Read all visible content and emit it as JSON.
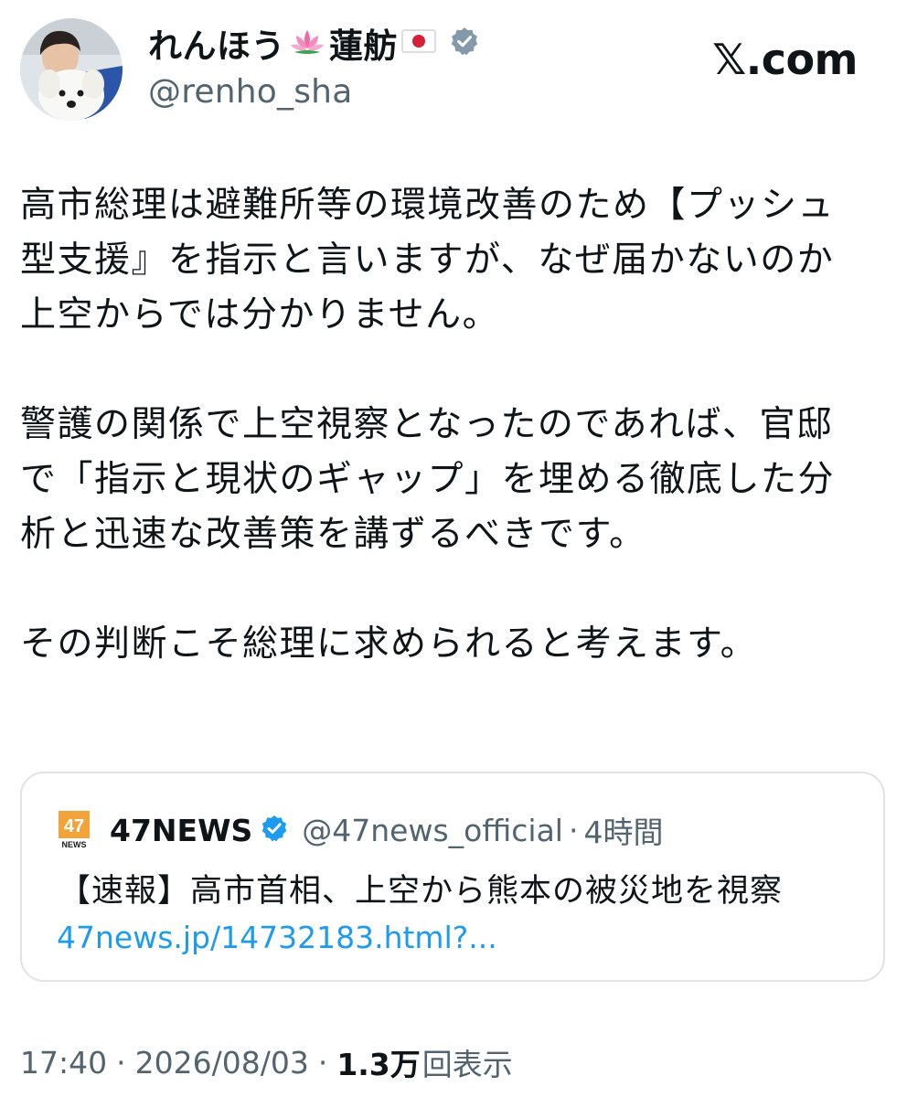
{
  "author": {
    "display_name": "れんほう",
    "display_name_2": "蓮舫",
    "handle": "@renho_sha"
  },
  "brand": "𝕏.com",
  "tweet": {
    "paragraphs": [
      "高市総理は避難所等の環境改善のため【プッシュ\n型支援』を指示と言いますが、なぜ届かないのか\n上空からでは分かりません。",
      "警護の関係で上空視察となったのであれば、官邸\nで「指示と現状のギャップ」を埋める徹底した分\n析と迅速な改善策を講ずるべきです。",
      "その判断こそ総理に求められると考えます。"
    ]
  },
  "quote": {
    "logo_text": "47",
    "logo_sub": "NEWS",
    "name": "47NEWS",
    "handle": "@47news_official",
    "separator": "·",
    "time": "4時間",
    "text": "【速報】高市首相、上空から熊本の被災地を視察",
    "link": "47news.jp/14732183.html?..."
  },
  "meta": {
    "time": "17:40",
    "separator": "·",
    "date": "2026/08/03",
    "views_count": "1.3万",
    "views_label": "回表示"
  },
  "colors": {
    "text": "#0f1419",
    "secondary": "#536471",
    "link": "#1d9bf0",
    "verified": "#1d9bf0",
    "border": "#dfe3e6"
  },
  "icons": {
    "avatar": "avatar-photo",
    "lotus": "lotus-icon",
    "flag": "japan-flag-icon",
    "verified": "verified-badge-icon"
  }
}
